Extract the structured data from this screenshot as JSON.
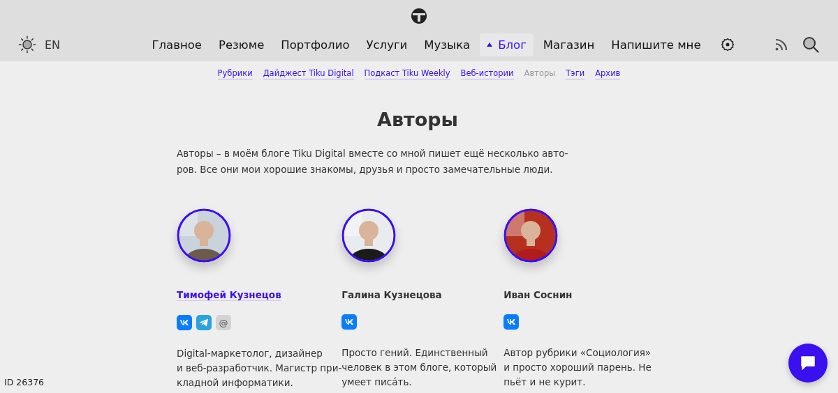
{
  "header": {
    "language": "EN",
    "nav": [
      {
        "label": "Главное",
        "selected": false
      },
      {
        "label": "Резюме",
        "selected": false
      },
      {
        "label": "Портфолио",
        "selected": false
      },
      {
        "label": "Услуги",
        "selected": false
      },
      {
        "label": "Музыка",
        "selected": false
      },
      {
        "label": "Блог",
        "selected": true
      },
      {
        "label": "Магазин",
        "selected": false
      },
      {
        "label": "Напишите мне",
        "selected": false
      }
    ]
  },
  "subnav": [
    {
      "label": "Рубрики",
      "selected": false
    },
    {
      "label": "Дайджест Tiku Digital",
      "selected": false
    },
    {
      "label": "Подкаст Tiku Weekly",
      "selected": false
    },
    {
      "label": "Веб-истории",
      "selected": false
    },
    {
      "label": "Авторы",
      "selected": true
    },
    {
      "label": "Тэги",
      "selected": false
    },
    {
      "label": "Архив",
      "selected": false
    }
  ],
  "title": "Авторы",
  "intro_lines": [
    "Авторы – в моём блоге Tiku Digital вместе со мной пишет ещё несколько авто-",
    "ров. Все они мои хорошие знакомы, друзья и просто замечательные люди."
  ],
  "authors": [
    {
      "name": "Тимофей Кузнецов",
      "linked": true,
      "links": [
        {
          "kind": "vk"
        },
        {
          "kind": "telegram"
        },
        {
          "kind": "email",
          "symbol": "@"
        }
      ],
      "bio_lines": [
        "Digital-маркетолог, дизайнер",
        "и веб-разработчик. Магистр при-",
        "кладной информатики."
      ]
    },
    {
      "name": "Галина Кузнецова",
      "linked": false,
      "links": [
        {
          "kind": "vk"
        }
      ],
      "bio_lines": [
        "Просто гений. Единственный",
        "человек в этом блоге, который",
        "умеет писа́ть."
      ]
    },
    {
      "name": "Иван Соснин",
      "linked": false,
      "links": [
        {
          "kind": "vk"
        }
      ],
      "bio_lines": [
        "Автор рубрики «Социология»",
        "и просто хороший парень. Не",
        "пьёт и не курит."
      ]
    }
  ],
  "page_id": "ID 26376"
}
